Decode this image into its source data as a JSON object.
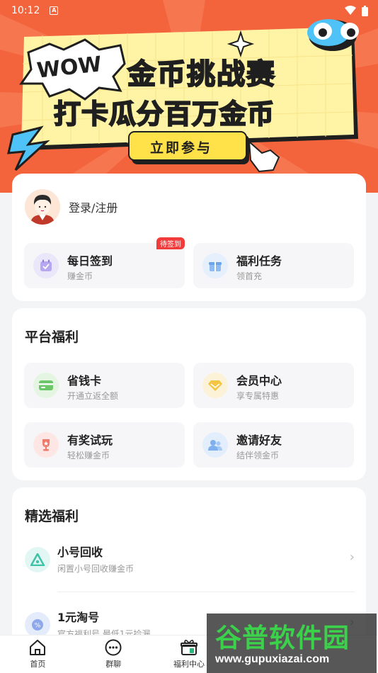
{
  "status_bar": {
    "time": "10:12"
  },
  "banner": {
    "wow": "WOW",
    "title": "金币挑战赛",
    "subtitle": "打卡瓜分百万金币",
    "cta": "立即参与"
  },
  "user": {
    "login_label": "登录/注册"
  },
  "quick": [
    {
      "title": "每日签到",
      "desc": "赚金币",
      "badge": "待签到"
    },
    {
      "title": "福利任务",
      "desc": "领首充"
    }
  ],
  "platform": {
    "title": "平台福利",
    "items": [
      {
        "title": "省钱卡",
        "desc": "开通立返全额"
      },
      {
        "title": "会员中心",
        "desc": "享专属特惠"
      },
      {
        "title": "有奖试玩",
        "desc": "轻松赚金币"
      },
      {
        "title": "邀请好友",
        "desc": "结伴领金币"
      }
    ]
  },
  "selected": {
    "title": "精选福利",
    "items": [
      {
        "title": "小号回收",
        "desc": "闲置小号回收赚金币"
      },
      {
        "title": "1元淘号",
        "desc": "官方福利号 最低1元捡漏"
      }
    ]
  },
  "nav": [
    {
      "label": "首页",
      "icon": "home-icon"
    },
    {
      "label": "群聊",
      "icon": "chat-icon"
    },
    {
      "label": "福利中心",
      "icon": "gift-icon"
    }
  ],
  "watermark": {
    "logo": "谷普软件园",
    "url": "www.gupuxiazai.com"
  },
  "colors": {
    "banner_bg": "#f4643c",
    "accent_yellow": "#ffe14a",
    "badge_red": "#f23c3c"
  }
}
